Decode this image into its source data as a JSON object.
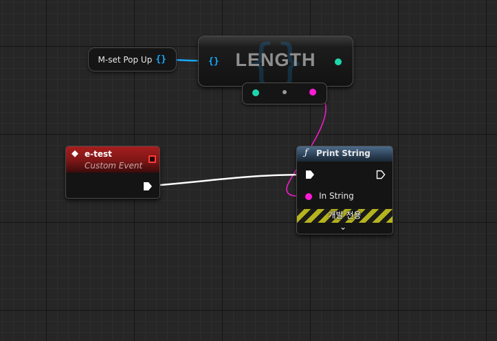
{
  "variable_node": {
    "label": "M-set Pop Up",
    "icon": "{}"
  },
  "length_node": {
    "title": "LENGTH",
    "input_icon": "{}"
  },
  "event_node": {
    "title": "e-test",
    "subtitle": "Custom Event"
  },
  "print_node": {
    "title": "Print String",
    "input_label": "In String",
    "dev_only_label": "개발 전용"
  },
  "colors": {
    "array_pin": "#19a9ff",
    "int_pin": "#1fd6ac",
    "string_pin": "#ff1bd5",
    "exec_wire": "#ffffff",
    "event_header": "#a81e1e",
    "function_header": "#4d6b8a"
  }
}
